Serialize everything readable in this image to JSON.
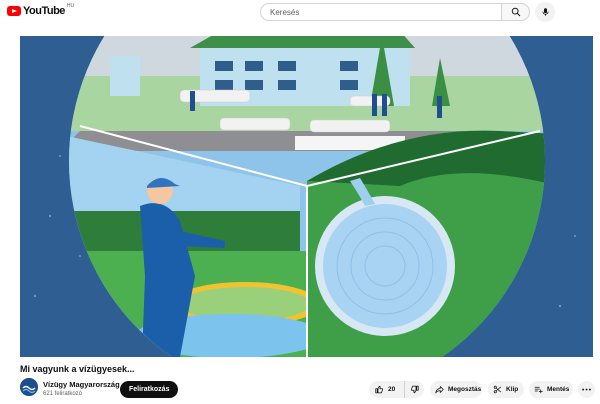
{
  "logo": {
    "text": "YouTube",
    "region": "HU"
  },
  "search": {
    "placeholder": "Keresés"
  },
  "icons": {
    "search": "search-icon",
    "mic": "mic-icon",
    "like": "thumbs-up-icon",
    "dislike": "thumbs-down-icon",
    "share": "share-icon",
    "clip": "scissors-icon",
    "save": "save-playlist-icon",
    "more": "more-icon"
  },
  "video": {
    "title": "Mi vagyunk a vízügyesek..."
  },
  "channel": {
    "name": "Vízügy Magyarország",
    "subscribers": "621 feliratkozó",
    "subscribe_label": "Feliratkozás"
  },
  "actions": {
    "like_count": "20",
    "share_label": "Megosztás",
    "clip_label": "Klip",
    "save_label": "Mentés"
  },
  "colors": {
    "brand": "#ff0000",
    "video_bg": "#2f5e93",
    "subscribe_bg": "#0f0f0f"
  }
}
